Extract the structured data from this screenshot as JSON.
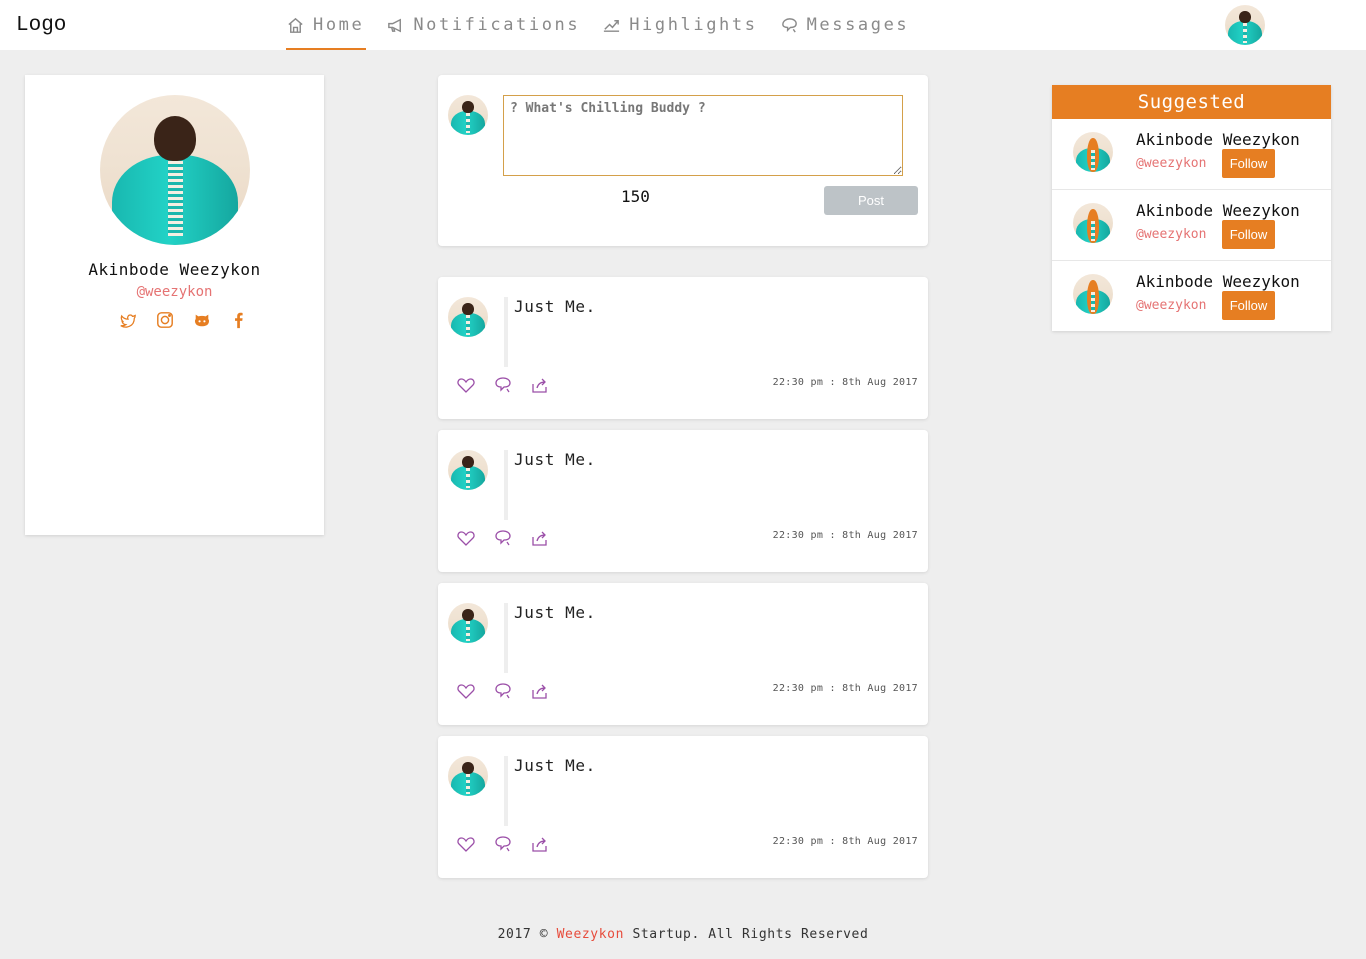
{
  "header": {
    "logo": "Logo",
    "nav": [
      {
        "label": "Home",
        "icon": "home-icon",
        "active": true
      },
      {
        "label": "Notifications",
        "icon": "megaphone-icon",
        "active": false
      },
      {
        "label": "Highlights",
        "icon": "trend-icon",
        "active": false
      },
      {
        "label": "Messages",
        "icon": "chat-icon",
        "active": false
      }
    ]
  },
  "profile": {
    "name": "Akinbode Weezykon",
    "handle": "@weezykon",
    "social": [
      "twitter-icon",
      "instagram-icon",
      "github-icon",
      "facebook-icon"
    ]
  },
  "compose": {
    "placeholder": "? What's Chilling Buddy ?",
    "char_count": "150",
    "post_label": "Post"
  },
  "posts": [
    {
      "text": "Just Me.",
      "time": "22:30 pm : 8th Aug 2017"
    },
    {
      "text": "Just Me.",
      "time": "22:30 pm : 8th Aug 2017"
    },
    {
      "text": "Just Me.",
      "time": "22:30 pm : 8th Aug 2017"
    },
    {
      "text": "Just Me.",
      "time": "22:30 pm : 8th Aug 2017"
    }
  ],
  "suggested": {
    "title": "Suggested",
    "users": [
      {
        "name": "Akinbode Weezykon",
        "handle": "@weezykon",
        "follow_label": "Follow"
      },
      {
        "name": "Akinbode Weezykon",
        "handle": "@weezykon",
        "follow_label": "Follow"
      },
      {
        "name": "Akinbode Weezykon",
        "handle": "@weezykon",
        "follow_label": "Follow"
      }
    ]
  },
  "footer": {
    "prefix": "2017 ©",
    "brand": "Weezykon",
    "suffix": "Startup. All Rights Reserved"
  },
  "colors": {
    "accent": "#e67e22",
    "handle": "#e57373",
    "action_icons": "#9b4fa8",
    "background": "#eeeeee"
  }
}
